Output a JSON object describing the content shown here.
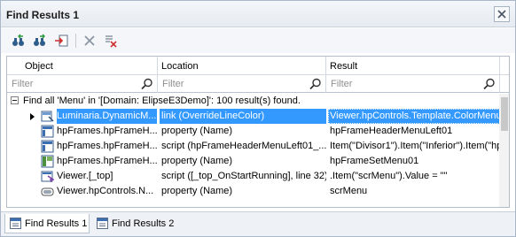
{
  "window": {
    "title": "Find Results 1"
  },
  "grid": {
    "columns": [
      "Object",
      "Location",
      "Result"
    ],
    "filter_placeholder": "Filter",
    "summary": "Find all 'Menu' in '[Domain: ElipseE3Demo]': 100 result(s) found.",
    "rows": [
      {
        "icon": "dynamic-menu-icon",
        "object": "Luminaria.DynamicM...",
        "location": "link (OverrideLineColor)",
        "result": "Viewer.hpControls.Template.ColorMenu",
        "selected": true
      },
      {
        "icon": "frame-icon",
        "object": "hpFrames.hpFrameH...",
        "location": "property (Name)",
        "result": "hpFrameHeaderMenuLeft01",
        "selected": false
      },
      {
        "icon": "frame-icon",
        "object": "hpFrames.hpFrameH...",
        "location": "script (hpFrameHeaderMenuLeft01_...",
        "result": "Item(\"Divisor1\").Item(\"Inferior\").Item(\"hp",
        "selected": false
      },
      {
        "icon": "frameset-icon",
        "object": "hpFrames.hpFrameH...",
        "location": "property (Name)",
        "result": "hpFrameSetMenu01",
        "selected": false
      },
      {
        "icon": "viewer-icon",
        "object": "Viewer.[_top]",
        "location": "script ([_top_OnStartRunning], line 32)",
        "result": ".Item(\"scrMenu\").Value = \"\"",
        "selected": false
      },
      {
        "icon": "control-icon",
        "object": "Viewer.hpControls.N...",
        "location": "property (Name)",
        "result": "scrMenu",
        "selected": false
      }
    ]
  },
  "tabs": [
    {
      "label": "Find Results 1",
      "active": true
    },
    {
      "label": "Find Results 2",
      "active": false
    }
  ],
  "colors": {
    "selection": "#3399ff",
    "title_bg": "#e6ebf1"
  }
}
